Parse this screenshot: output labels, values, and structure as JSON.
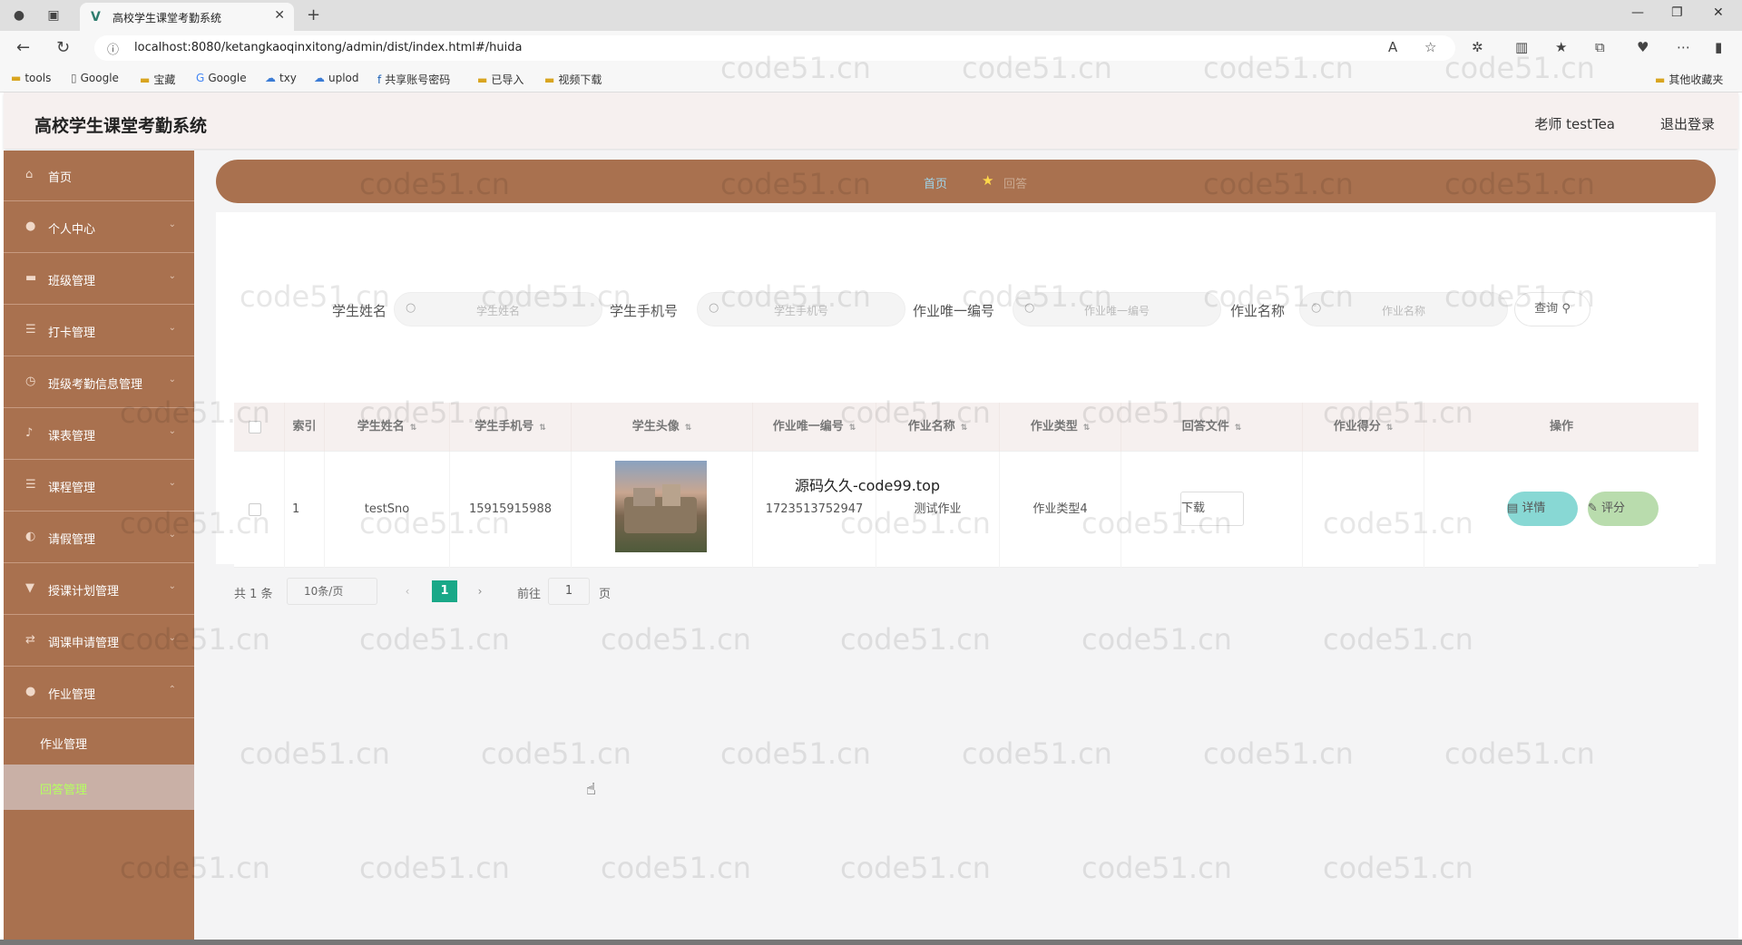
{
  "browser": {
    "tab_title": "高校学生课堂考勤系统",
    "url": "localhost:8080/ketangkaoqinxitong/admin/dist/index.html#/huida",
    "bookmarks": [
      "tools",
      "Google",
      "宝藏",
      "Google",
      "txy",
      "uplod",
      "共享账号密码",
      "已导入",
      "视频下载"
    ],
    "other_bookmarks": "其他收藏夹"
  },
  "header": {
    "title": "高校学生课堂考勤系统",
    "user": "老师 testTea",
    "logout": "退出登录"
  },
  "sidebar": {
    "items": [
      {
        "label": "首页",
        "icon": "home-icon"
      },
      {
        "label": "个人中心",
        "icon": "user-icon"
      },
      {
        "label": "班级管理",
        "icon": "class-icon"
      },
      {
        "label": "打卡管理",
        "icon": "list-icon"
      },
      {
        "label": "班级考勤信息管理",
        "icon": "clock-icon"
      },
      {
        "label": "课表管理",
        "icon": "bell-icon"
      },
      {
        "label": "课程管理",
        "icon": "list-icon"
      },
      {
        "label": "请假管理",
        "icon": "leave-icon"
      },
      {
        "label": "授课计划管理",
        "icon": "plan-icon"
      },
      {
        "label": "调课申请管理",
        "icon": "swap-icon"
      },
      {
        "label": "作业管理",
        "icon": "user-icon"
      }
    ],
    "subitems": [
      {
        "label": "作业管理"
      },
      {
        "label": "回答管理"
      }
    ]
  },
  "breadcrumb": {
    "home": "首页",
    "current": "回答"
  },
  "filters": [
    {
      "label": "学生姓名",
      "placeholder": "学生姓名"
    },
    {
      "label": "学生手机号",
      "placeholder": "学生手机号"
    },
    {
      "label": "作业唯一编号",
      "placeholder": "作业唯一编号"
    },
    {
      "label": "作业名称",
      "placeholder": "作业名称"
    }
  ],
  "query_button": "查询",
  "table": {
    "columns": [
      "索引",
      "学生姓名",
      "学生手机号",
      "学生头像",
      "作业唯一编号",
      "作业名称",
      "作业类型",
      "回答文件",
      "作业得分",
      "操作"
    ],
    "rows": [
      {
        "index": "1",
        "name": "testSno",
        "phone": "15915915988",
        "homework_id": "1723513752947",
        "homework_name": "测试作业",
        "homework_type": "作业类型4",
        "file_button": "下载",
        "score": "",
        "detail": "详情",
        "rate": "评分"
      }
    ]
  },
  "pagination": {
    "total": "共 1 条",
    "page_size": "10条/页",
    "current": "1",
    "goto_label": "前往",
    "goto_value": "1",
    "page_suffix": "页"
  },
  "overlay_text": "源码久久-code99.top",
  "watermark": "code51.cn"
}
